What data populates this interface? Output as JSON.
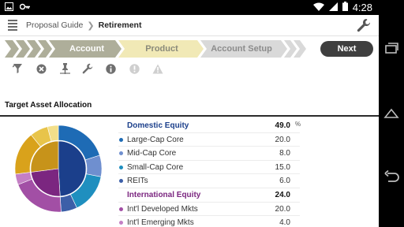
{
  "status_bar": {
    "time": "4:28",
    "left_icons": [
      "image-icon",
      "key-icon"
    ],
    "right_icons": [
      "wifi-icon",
      "signal-icon",
      "battery-icon"
    ]
  },
  "header": {
    "breadcrumb_root": "Proposal Guide",
    "breadcrumb_current": "Retirement"
  },
  "workflow": {
    "steps": [
      {
        "label": "Account",
        "state": "complete",
        "color": "#aeae9a"
      },
      {
        "label": "Product",
        "state": "current",
        "color": "#f1e9b6"
      },
      {
        "label": "Account Setup",
        "state": "upcoming",
        "color": "#d9d9d9"
      }
    ],
    "next_label": "Next"
  },
  "toolbar": {
    "icons": [
      "funnel-icon",
      "close-circle-icon",
      "pin-icon",
      "wrench-icon",
      "info-icon",
      "alert-circle-icon",
      "warning-icon"
    ]
  },
  "section": {
    "title": "Target Asset Allocation"
  },
  "allocation": {
    "percent_sign": "%",
    "groups": [
      {
        "name": "Domestic Equity",
        "value": "49.0",
        "color": "#1b3f8b",
        "items": [
          {
            "name": "Large-Cap Core",
            "value": "20.0",
            "color": "#1e6bb5"
          },
          {
            "name": "Mid-Cap Core",
            "value": "8.0",
            "color": "#6f8fcf"
          },
          {
            "name": "Small-Cap Core",
            "value": "15.0",
            "color": "#1f8fbf"
          },
          {
            "name": "REITs",
            "value": "6.0",
            "color": "#3c5fa8"
          }
        ]
      },
      {
        "name": "International Equity",
        "value": "24.0",
        "color": "#7b2680",
        "items": [
          {
            "name": "Int'l Developed Mkts",
            "value": "20.0",
            "color": "#a24fa5"
          },
          {
            "name": "Int'l Emerging Mkts",
            "value": "4.0",
            "color": "#c47fc4"
          }
        ]
      }
    ]
  },
  "nav_bar": {
    "icons": [
      "recent-apps-icon",
      "home-icon",
      "back-icon"
    ]
  }
}
